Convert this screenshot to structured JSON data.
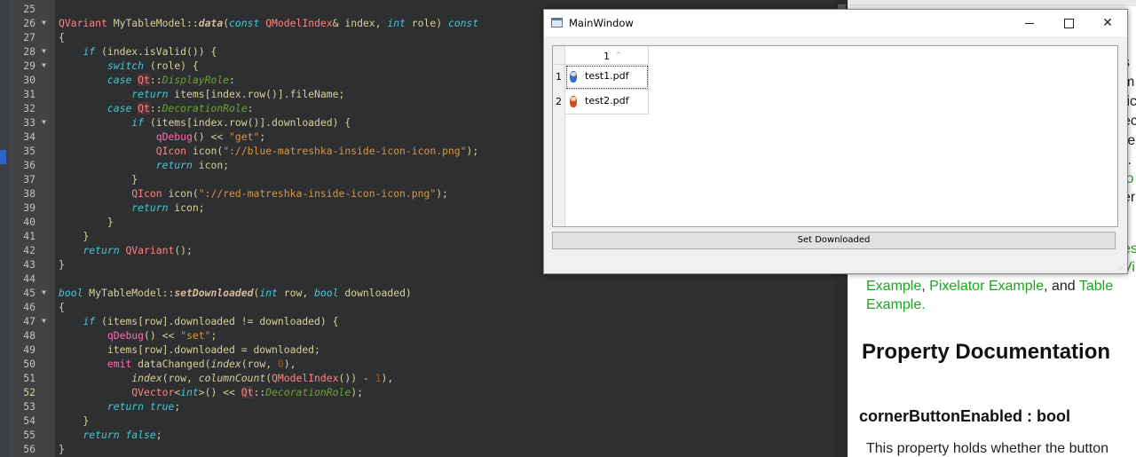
{
  "editor": {
    "current_line": "52",
    "lines": [
      {
        "n": "25",
        "fold": "",
        "segs": []
      },
      {
        "n": "26",
        "fold": "▼",
        "segs": [
          [
            "t-type",
            "QVariant"
          ],
          [
            "t-plain",
            " MyTableModel::"
          ],
          [
            "t-fn",
            "data"
          ],
          [
            "t-plain",
            "("
          ],
          [
            "t-kw",
            "const"
          ],
          [
            "t-plain",
            " "
          ],
          [
            "t-type",
            "QModelIndex"
          ],
          [
            "t-plain",
            "& index, "
          ],
          [
            "t-kw",
            "int"
          ],
          [
            "t-plain",
            " role) "
          ],
          [
            "t-kw",
            "const"
          ]
        ]
      },
      {
        "n": "27",
        "fold": "",
        "segs": [
          [
            "t-plain",
            "{"
          ]
        ]
      },
      {
        "n": "28",
        "fold": "▼",
        "segs": [
          [
            "t-plain",
            "    "
          ],
          [
            "t-kw",
            "if"
          ],
          [
            "t-plain",
            " (index.isValid()) {"
          ]
        ]
      },
      {
        "n": "29",
        "fold": "▼",
        "segs": [
          [
            "t-plain",
            "        "
          ],
          [
            "t-kw",
            "switch"
          ],
          [
            "t-plain",
            " (role) {"
          ]
        ]
      },
      {
        "n": "30",
        "fold": "",
        "segs": [
          [
            "t-plain",
            "        "
          ],
          [
            "t-kw",
            "case"
          ],
          [
            "t-plain",
            " "
          ],
          [
            "t-qt",
            "Qt"
          ],
          [
            "t-plain",
            "::"
          ],
          [
            "t-enum",
            "DisplayRole"
          ],
          [
            "t-plain",
            ":"
          ]
        ]
      },
      {
        "n": "31",
        "fold": "",
        "segs": [
          [
            "t-plain",
            "            "
          ],
          [
            "t-kw",
            "return"
          ],
          [
            "t-plain",
            " items[index.row()].fileName;"
          ]
        ]
      },
      {
        "n": "32",
        "fold": "",
        "segs": [
          [
            "t-plain",
            "        "
          ],
          [
            "t-kw",
            "case"
          ],
          [
            "t-plain",
            " "
          ],
          [
            "t-qt",
            "Qt"
          ],
          [
            "t-plain",
            "::"
          ],
          [
            "t-enum",
            "DecorationRole"
          ],
          [
            "t-plain",
            ":"
          ]
        ]
      },
      {
        "n": "33",
        "fold": "▼",
        "segs": [
          [
            "t-plain",
            "            "
          ],
          [
            "t-kw",
            "if"
          ],
          [
            "t-plain",
            " (items[index.row()].downloaded) {"
          ]
        ]
      },
      {
        "n": "34",
        "fold": "",
        "segs": [
          [
            "t-plain",
            "                "
          ],
          [
            "t-macro",
            "qDebug"
          ],
          [
            "t-plain",
            "() << "
          ],
          [
            "t-str",
            "\"get\""
          ],
          [
            "t-plain",
            ";"
          ]
        ]
      },
      {
        "n": "35",
        "fold": "",
        "segs": [
          [
            "t-plain",
            "                "
          ],
          [
            "t-type",
            "QIcon"
          ],
          [
            "t-plain",
            " icon("
          ],
          [
            "t-str",
            "\"://blue-matreshka-inside-icon-icon.png\""
          ],
          [
            "t-plain",
            ");"
          ]
        ]
      },
      {
        "n": "36",
        "fold": "",
        "segs": [
          [
            "t-plain",
            "                "
          ],
          [
            "t-kw",
            "return"
          ],
          [
            "t-plain",
            " icon;"
          ]
        ]
      },
      {
        "n": "37",
        "fold": "",
        "segs": [
          [
            "t-plain",
            "            }"
          ]
        ]
      },
      {
        "n": "38",
        "fold": "",
        "segs": [
          [
            "t-plain",
            "            "
          ],
          [
            "t-type",
            "QIcon"
          ],
          [
            "t-plain",
            " icon("
          ],
          [
            "t-str",
            "\"://red-matreshka-inside-icon-icon.png\""
          ],
          [
            "t-plain",
            ");"
          ]
        ]
      },
      {
        "n": "39",
        "fold": "",
        "segs": [
          [
            "t-plain",
            "            "
          ],
          [
            "t-kw",
            "return"
          ],
          [
            "t-plain",
            " icon;"
          ]
        ]
      },
      {
        "n": "40",
        "fold": "",
        "segs": [
          [
            "t-plain",
            "        }"
          ]
        ]
      },
      {
        "n": "41",
        "fold": "",
        "segs": [
          [
            "t-plain",
            "    }"
          ]
        ]
      },
      {
        "n": "42",
        "fold": "",
        "segs": [
          [
            "t-plain",
            "    "
          ],
          [
            "t-kw",
            "return"
          ],
          [
            "t-plain",
            " "
          ],
          [
            "t-type",
            "QVariant"
          ],
          [
            "t-plain",
            "();"
          ]
        ]
      },
      {
        "n": "43",
        "fold": "",
        "segs": [
          [
            "t-plain",
            "}"
          ]
        ]
      },
      {
        "n": "44",
        "fold": "",
        "segs": []
      },
      {
        "n": "45",
        "fold": "▼",
        "segs": [
          [
            "t-kw",
            "bool"
          ],
          [
            "t-plain",
            " MyTableModel::"
          ],
          [
            "t-fn",
            "setDownloaded"
          ],
          [
            "t-plain",
            "("
          ],
          [
            "t-kw",
            "int"
          ],
          [
            "t-plain",
            " row, "
          ],
          [
            "t-kw",
            "bool"
          ],
          [
            "t-plain",
            " downloaded)"
          ]
        ]
      },
      {
        "n": "46",
        "fold": "",
        "segs": [
          [
            "t-plain",
            "{"
          ]
        ]
      },
      {
        "n": "47",
        "fold": "▼",
        "segs": [
          [
            "t-plain",
            "    "
          ],
          [
            "t-kw",
            "if"
          ],
          [
            "t-plain",
            " (items[row].downloaded != downloaded) {"
          ]
        ]
      },
      {
        "n": "48",
        "fold": "",
        "segs": [
          [
            "t-plain",
            "        "
          ],
          [
            "t-macro",
            "qDebug"
          ],
          [
            "t-plain",
            "() << "
          ],
          [
            "t-str",
            "\"set\""
          ],
          [
            "t-plain",
            ";"
          ]
        ]
      },
      {
        "n": "49",
        "fold": "",
        "segs": [
          [
            "t-plain",
            "        items[row].downloaded = downloaded;"
          ]
        ]
      },
      {
        "n": "50",
        "fold": "",
        "segs": [
          [
            "t-plain",
            "        "
          ],
          [
            "t-macro",
            "emit"
          ],
          [
            "t-plain",
            " dataChanged("
          ],
          [
            "t-fni",
            "index"
          ],
          [
            "t-plain",
            "(row, "
          ],
          [
            "t-num",
            "0"
          ],
          [
            "t-plain",
            "),"
          ]
        ]
      },
      {
        "n": "51",
        "fold": "",
        "segs": [
          [
            "t-plain",
            "            "
          ],
          [
            "t-fni",
            "index"
          ],
          [
            "t-plain",
            "(row, "
          ],
          [
            "t-fni",
            "columnCount"
          ],
          [
            "t-plain",
            "("
          ],
          [
            "t-type",
            "QModelIndex"
          ],
          [
            "t-plain",
            "()) - "
          ],
          [
            "t-num",
            "1"
          ],
          [
            "t-plain",
            "),"
          ]
        ]
      },
      {
        "n": "52",
        "fold": "",
        "segs": [
          [
            "t-plain",
            "            "
          ],
          [
            "t-type",
            "QVector"
          ],
          [
            "t-plain",
            "<"
          ],
          [
            "t-kw",
            "int"
          ],
          [
            "t-plain",
            ">() << "
          ],
          [
            "t-qt",
            "Qt"
          ],
          [
            "t-plain",
            "::"
          ],
          [
            "t-enum",
            "DecorationRole"
          ],
          [
            "t-plain",
            ");"
          ]
        ]
      },
      {
        "n": "53",
        "fold": "",
        "segs": [
          [
            "t-plain",
            "        "
          ],
          [
            "t-kw",
            "return"
          ],
          [
            "t-plain",
            " "
          ],
          [
            "t-kw",
            "true"
          ],
          [
            "t-plain",
            ";"
          ]
        ]
      },
      {
        "n": "54",
        "fold": "",
        "segs": [
          [
            "t-plain",
            "    }"
          ]
        ]
      },
      {
        "n": "55",
        "fold": "",
        "segs": [
          [
            "t-plain",
            "    "
          ],
          [
            "t-kw",
            "return"
          ],
          [
            "t-plain",
            " "
          ],
          [
            "t-kw",
            "false"
          ],
          [
            "t-plain",
            ";"
          ]
        ]
      },
      {
        "n": "56",
        "fold": "",
        "segs": [
          [
            "t-plain",
            "}"
          ]
        ]
      }
    ]
  },
  "main_window": {
    "title": "MainWindow",
    "close_glyph": "✕",
    "column_header": "1",
    "sort_glyph": "^",
    "rows": [
      {
        "header": "1",
        "file": "test1.pdf",
        "icon": "blue-matreshka-icon"
      },
      {
        "header": "2",
        "file": "test2.pdf",
        "icon": "red-matreshka-icon"
      }
    ],
    "button_label": "Set Downloaded"
  },
  "docs": {
    "fragments": [
      {
        "t": "s i",
        "g": false
      },
      {
        "t": "m",
        "g": false
      },
      {
        "t": "tic",
        "g": false
      },
      {
        "t": "ec",
        "g": false
      },
      {
        "t": "re",
        "g": false
      },
      {
        "t": ").",
        "g": false
      },
      {
        "t": "io",
        "g": true
      },
      {
        "t": "er",
        "g": false
      },
      {
        "t": "es",
        "g": true
      },
      {
        "t": "Vi",
        "g": true
      }
    ],
    "example_line": {
      "a": "Example",
      "b": ", ",
      "c": "Pixelator Example",
      "d": ", and ",
      "e": "Table"
    },
    "example_line2": "Example.",
    "heading": "Property Documentation",
    "property": "cornerButtonEnabled : bool",
    "description": "This property holds whether the button"
  },
  "colors": {
    "accent_link": "#17a81a",
    "editor_bg": "#2e2f30"
  }
}
